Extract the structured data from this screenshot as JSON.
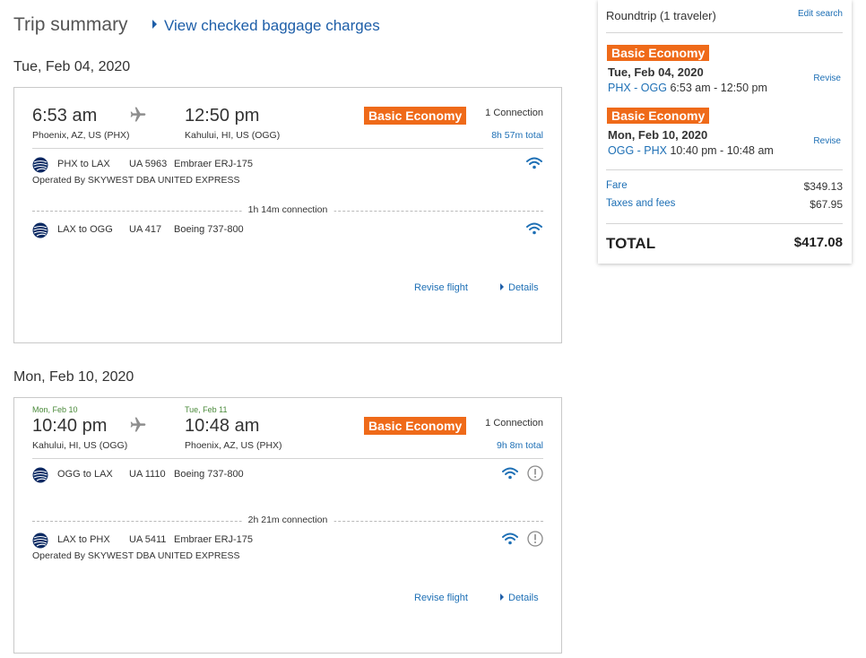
{
  "page": {
    "title": "Trip summary",
    "baggage_link": "View checked baggage charges"
  },
  "colors": {
    "brand_blue": "#1d6fb5",
    "fare_orange": "#ef6a19",
    "date_green": "#4a8a3a"
  },
  "trips": [
    {
      "heading": "Tue, Feb 04, 2020",
      "dep_date": "",
      "arr_date": "",
      "dep_time": "6:53 am",
      "arr_time": "12:50 pm",
      "dep_place": "Phoenix, AZ, US (PHX)",
      "arr_place": "Kahului, HI, US (OGG)",
      "fare_class": "Basic Economy",
      "connections": "1 Connection",
      "total_time": "8h 57m total",
      "segments": [
        {
          "route": "PHX to LAX",
          "flight": "UA 5963",
          "aircraft": "Embraer ERJ-175",
          "operated_by": "Operated By SKYWEST DBA UNITED EXPRESS",
          "wifi": true,
          "alert": false
        },
        {
          "route": "LAX to OGG",
          "flight": "UA 417",
          "aircraft": "Boeing 737-800",
          "operated_by": "",
          "wifi": true,
          "alert": false
        }
      ],
      "layover": "1h 14m connection",
      "revise_label": "Revise flight",
      "details_label": "Details"
    },
    {
      "heading": "Mon, Feb 10, 2020",
      "dep_date": "Mon, Feb 10",
      "arr_date": "Tue, Feb 11",
      "dep_time": "10:40 pm",
      "arr_time": "10:48 am",
      "dep_place": "Kahului, HI, US (OGG)",
      "arr_place": "Phoenix, AZ, US (PHX)",
      "fare_class": "Basic Economy",
      "connections": "1 Connection",
      "total_time": "9h 8m total",
      "segments": [
        {
          "route": "OGG to LAX",
          "flight": "UA 1110",
          "aircraft": "Boeing 737-800",
          "operated_by": "",
          "wifi": true,
          "alert": true
        },
        {
          "route": "LAX to PHX",
          "flight": "UA 5411",
          "aircraft": "Embraer ERJ-175",
          "operated_by": "Operated By SKYWEST DBA UNITED EXPRESS",
          "wifi": true,
          "alert": true
        }
      ],
      "layover": "2h 21m connection",
      "revise_label": "Revise flight",
      "details_label": "Details"
    }
  ],
  "summary": {
    "roundtrip": "Roundtrip (1 traveler)",
    "edit_search": "Edit search",
    "legs": [
      {
        "fare_class": "Basic Economy",
        "date": "Tue, Feb 04, 2020",
        "codes": "PHX - OGG",
        "times": "6:53 am - 12:50 pm",
        "revise": "Revise"
      },
      {
        "fare_class": "Basic Economy",
        "date": "Mon, Feb 10, 2020",
        "codes": "OGG - PHX",
        "times": "10:40 pm - 10:48 am",
        "revise": "Revise"
      }
    ],
    "fare_label": "Fare",
    "fare_value": "$349.13",
    "taxes_label": "Taxes and fees",
    "taxes_value": "$67.95",
    "total_label": "TOTAL",
    "total_value": "$417.08"
  }
}
